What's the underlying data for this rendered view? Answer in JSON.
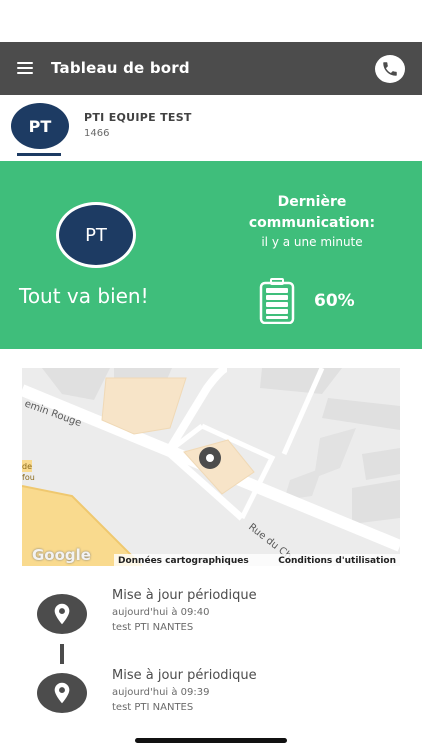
{
  "header": {
    "title": "Tableau de bord"
  },
  "tab": {
    "initials": "PT",
    "name": "PTI EQUIPE TEST",
    "id": "1466"
  },
  "status": {
    "initials": "PT",
    "message": "Tout va bien!",
    "comm_title": "Dernière communication:",
    "comm_time": "il y a une minute",
    "battery": "60%",
    "battery_level": 0.6
  },
  "map": {
    "street_1": "emin Rouge",
    "street_2": "Rue du Ch",
    "label_de": "de",
    "label_fou": "fou",
    "google": "Google",
    "attribution_1": "Données cartographiques",
    "attribution_2": "Conditions d'utilisation"
  },
  "timeline": [
    {
      "title": "Mise à jour périodique",
      "time": "aujourd'hui à 09:40",
      "user": "test PTI NANTES"
    },
    {
      "title": "Mise à jour périodique",
      "time": "aujourd'hui à 09:39",
      "user": "test PTI NANTES"
    }
  ],
  "colors": {
    "bar": "#4c4c4c",
    "green": "#3fbe7b",
    "navy": "#1d3b63"
  },
  "icons": {
    "menu": "hamburger-icon",
    "call": "phone-icon",
    "battery": "battery-icon",
    "pin": "location-pin-icon"
  }
}
